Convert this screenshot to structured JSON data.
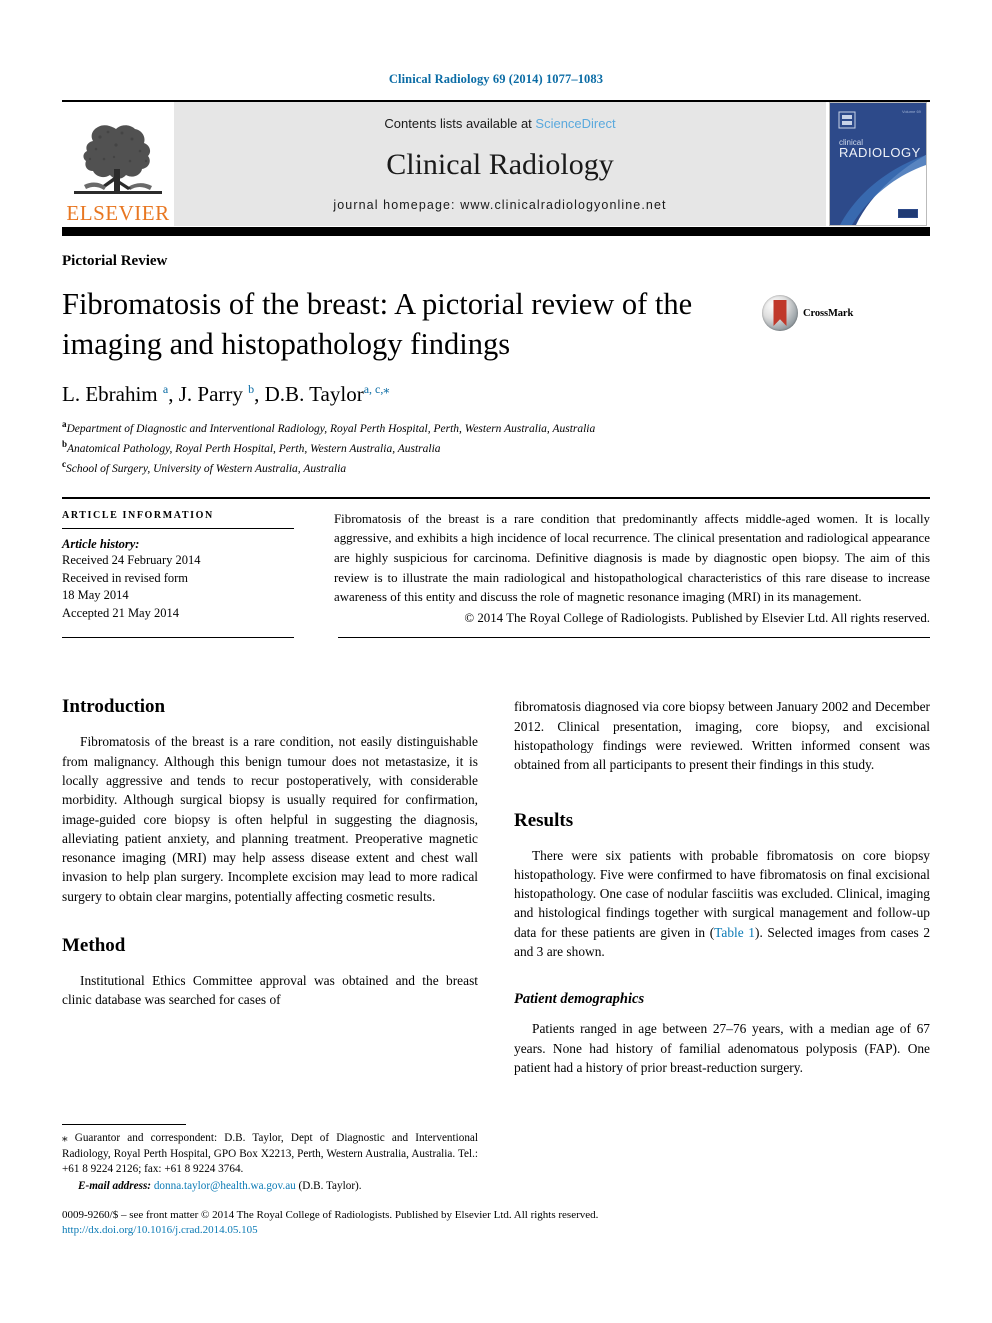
{
  "running_head": "Clinical Radiology 69 (2014) 1077–1083",
  "banner": {
    "publisher_name": "ELSEVIER",
    "contents_prefix": "Contents lists available at ",
    "contents_link": "ScienceDirect",
    "journal_name": "Clinical Radiology",
    "homepage_line": "journal homepage: www.clinicalradiologyonline.net",
    "cover_title_small": "clinical",
    "cover_title_large": "RADIOLOGY"
  },
  "article": {
    "type": "Pictorial Review",
    "title": "Fibromatosis of the breast: A pictorial review of the imaging and histopathology findings",
    "crossmark_label": "CrossMark",
    "authors_html": "L. Ebrahim <sup>a</sup>, J. Parry <sup>b</sup>, D.B. Taylor<sup>a, c,</sup><sup class=\"star\">⁎</sup>",
    "affiliations": [
      {
        "marker": "a",
        "text": "Department of Diagnostic and Interventional Radiology, Royal Perth Hospital, Perth, Western Australia, Australia"
      },
      {
        "marker": "b",
        "text": "Anatomical Pathology, Royal Perth Hospital, Perth, Western Australia, Australia"
      },
      {
        "marker": "c",
        "text": "School of Surgery, University of Western Australia, Australia"
      }
    ]
  },
  "article_information": {
    "heading": "ARTICLE INFORMATION",
    "history_label": "Article history:",
    "history_lines": [
      "Received 24 February 2014",
      "Received in revised form",
      "18 May 2014",
      "Accepted 21 May 2014"
    ]
  },
  "abstract": {
    "text": "Fibromatosis of the breast is a rare condition that predominantly affects middle-aged women. It is locally aggressive, and exhibits a high incidence of local recurrence. The clinical presentation and radiological appearance are highly suspicious for carcinoma. Definitive diagnosis is made by diagnostic open biopsy. The aim of this review is to illustrate the main radiological and histopathological characteristics of this rare disease to increase awareness of this entity and discuss the role of magnetic resonance imaging (MRI) in its management.",
    "copyright": "© 2014 The Royal College of Radiologists. Published by Elsevier Ltd. All rights reserved."
  },
  "body": {
    "left": {
      "introduction_heading": "Introduction",
      "introduction_text": "Fibromatosis of the breast is a rare condition, not easily distinguishable from malignancy. Although this benign tumour does not metastasize, it is locally aggressive and tends to recur postoperatively, with considerable morbidity. Although surgical biopsy is usually required for confirmation, image-guided core biopsy is often helpful in suggesting the diagnosis, alleviating patient anxiety, and planning treatment. Preoperative magnetic resonance imaging (MRI) may help assess disease extent and chest wall invasion to help plan surgery. Incomplete excision may lead to more radical surgery to obtain clear margins, potentially affecting cosmetic results.",
      "method_heading": "Method",
      "method_text": "Institutional Ethics Committee approval was obtained and the breast clinic database was searched for cases of"
    },
    "right": {
      "method_continued": "fibromatosis diagnosed via core biopsy between January 2002 and December 2012. Clinical presentation, imaging, core biopsy, and excisional histopathology findings were reviewed. Written informed consent was obtained from all participants to present their findings in this study.",
      "results_heading": "Results",
      "results_text_before_link": "There were six patients with probable fibromatosis on core biopsy histopathology. Five were confirmed to have fibromatosis on final excisional histopathology. One case of nodular fasciitis was excluded. Clinical, imaging and histological findings together with surgical management and follow-up data for these patients are given in (",
      "results_link": "Table 1",
      "results_text_after_link": "). Selected images from cases 2 and 3 are shown.",
      "demographics_heading": "Patient demographics",
      "demographics_text": "Patients ranged in age between 27–76 years, with a median age of 67 years. None had history of familial adenomatous polyposis (FAP). One patient had a history of prior breast-reduction surgery."
    }
  },
  "footnote": {
    "correspondence": "⁎ Guarantor and correspondent: D.B. Taylor, Dept of Diagnostic and Interventional Radiology, Royal Perth Hospital, GPO Box X2213, Perth, Western Australia, Australia. Tel.: +61 8 9224 2126; fax: +61 8 9224 3764.",
    "email_label": "E-mail address:",
    "email": "donna.taylor@health.wa.gov.au",
    "email_suffix": "(D.B. Taylor)."
  },
  "colophon": {
    "line1": "0009-9260/$ – see front matter © 2014 The Royal College of Radiologists. Published by Elsevier Ltd. All rights reserved.",
    "line2": "http://dx.doi.org/10.1016/j.crad.2014.05.105"
  },
  "colors": {
    "link_blue": "#0b7ab5",
    "running_head_blue": "#0b6ca5",
    "sciencedirect_blue": "#5aa9dd",
    "elsevier_orange": "#e87722",
    "banner_gray": "#e6e6e6",
    "crossmark_red": "#c0392b"
  }
}
